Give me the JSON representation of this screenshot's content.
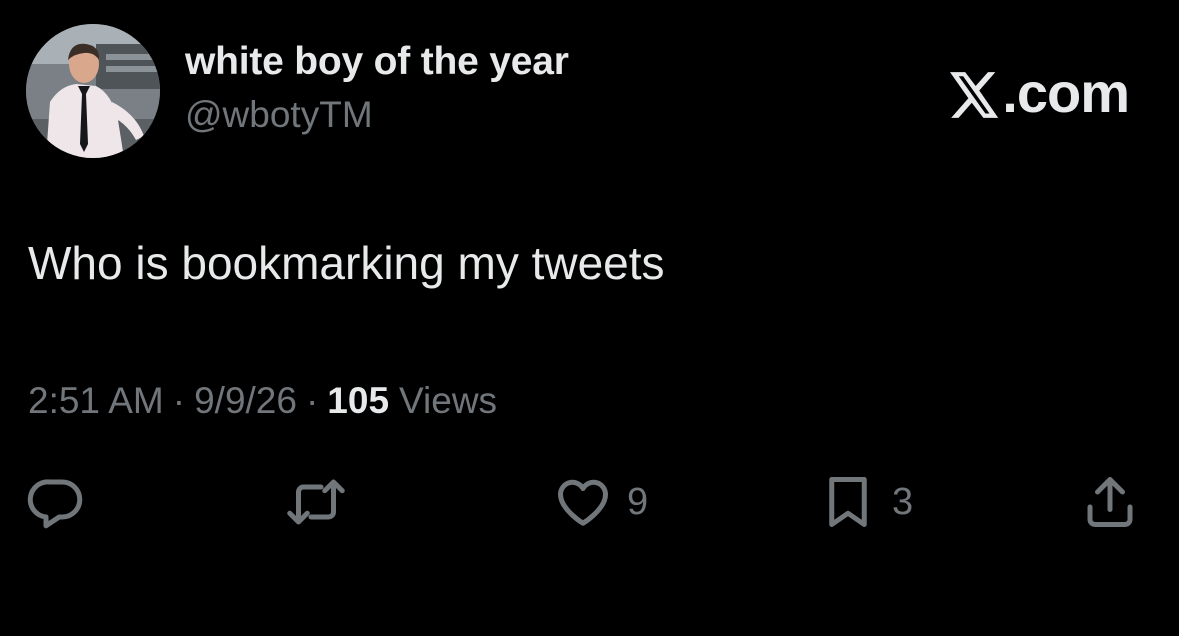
{
  "author": {
    "display_name": "white boy of the year",
    "handle": "@wbotyTM"
  },
  "brand": {
    "suffix": ".com",
    "icon": "x-logo-icon"
  },
  "tweet": {
    "text": "Who is bookmarking my tweets"
  },
  "meta": {
    "time": "2:51 AM",
    "separator": "·",
    "date": "9/9/26",
    "views_count": "105",
    "views_label": "Views"
  },
  "actions": {
    "reply": {
      "icon": "reply-icon"
    },
    "retweet": {
      "icon": "retweet-icon"
    },
    "like": {
      "icon": "heart-icon",
      "count": "9"
    },
    "bookmark": {
      "icon": "bookmark-icon",
      "count": "3"
    },
    "share": {
      "icon": "share-icon"
    }
  },
  "colors": {
    "background": "#000000",
    "primary_text": "#e7e9ea",
    "secondary_text": "#71767b"
  }
}
